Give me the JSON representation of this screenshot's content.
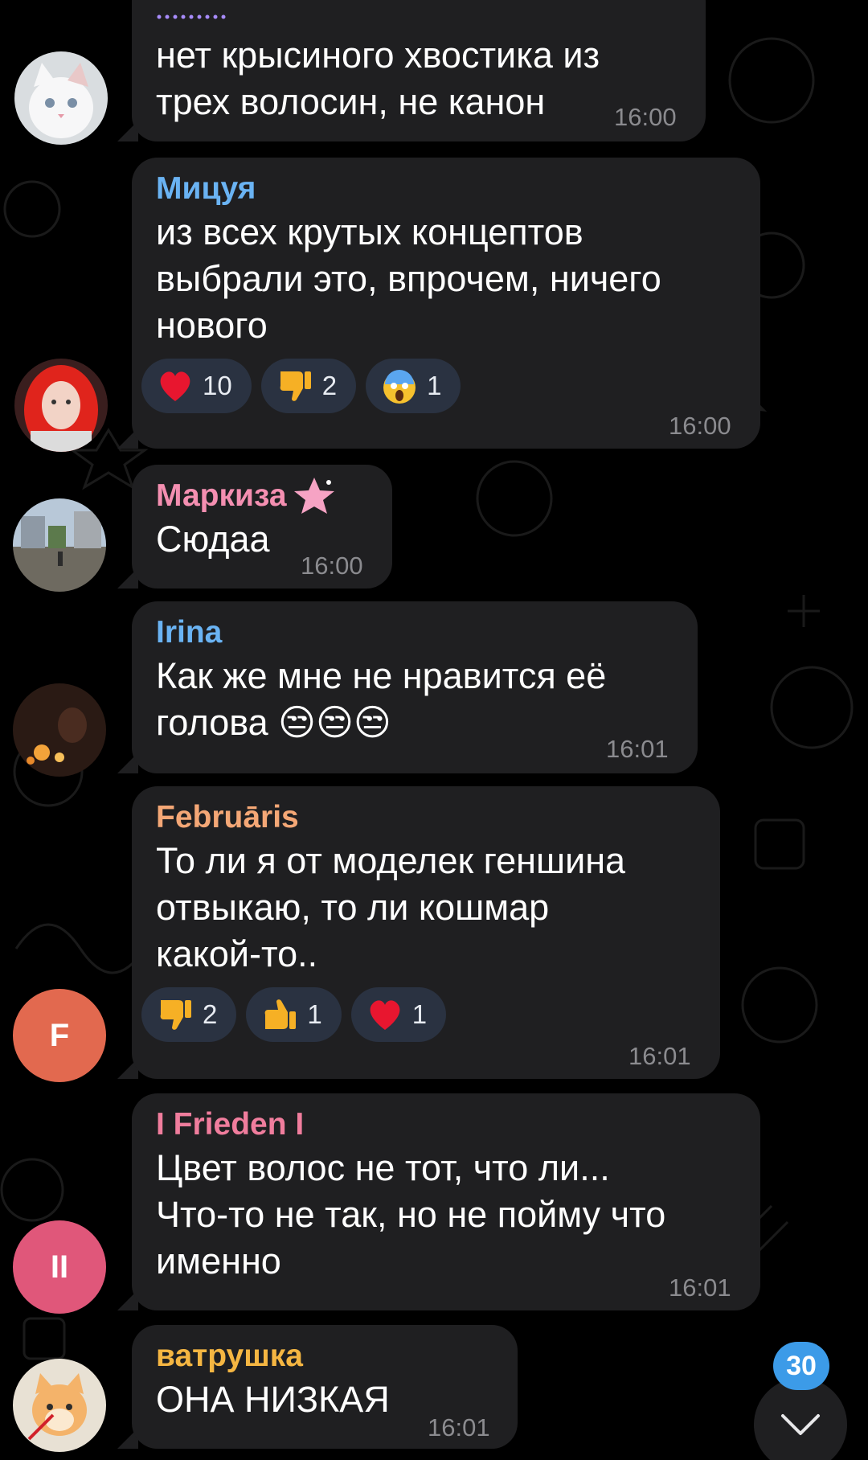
{
  "colors": {
    "background": "#000000",
    "bubble": "#1f1f21",
    "reaction_pill": "#2a3241",
    "time": "#8b8b8f",
    "accent": "#3c9be8"
  },
  "messages": [
    {
      "sender": "",
      "sender_color": "#a78bfa",
      "text": "нет крысиного хвостика из\nтрех волосин, не канон",
      "time": "16:00",
      "avatar": "white-kitten-avatar"
    },
    {
      "sender": "Мицуя",
      "sender_color": "#6ab3f3",
      "text": "из всех крутых концептов\nвыбрали это, впрочем, ничего\nнового",
      "time": "16:00",
      "avatar": "red-hair-girl-avatar",
      "reactions": [
        {
          "emoji": "heart",
          "count": "10"
        },
        {
          "emoji": "thumbs-down",
          "count": "2"
        },
        {
          "emoji": "scream",
          "count": "1"
        }
      ]
    },
    {
      "sender": "Маркиза",
      "sender_color": "#f48fb1",
      "badge": "pink-star-icon",
      "text": "Сюдаа",
      "time": "16:00",
      "avatar": "street-photo-avatar"
    },
    {
      "sender": "Irina",
      "sender_color": "#6ab3f3",
      "text": "Как же мне не нравится её\nголова 😒😒😒",
      "time": "16:01",
      "avatar": "candle-photo-avatar"
    },
    {
      "sender": "Februāris",
      "sender_color": "#f4a776",
      "text": "То ли я от моделек геншина\nотвыкаю, то ли кошмар\nкакой-то..",
      "time": "16:01",
      "avatar_letter": "F",
      "avatar_color": "#e2694f",
      "reactions": [
        {
          "emoji": "thumbs-down",
          "count": "2"
        },
        {
          "emoji": "thumbs-up",
          "count": "1"
        },
        {
          "emoji": "heart",
          "count": "1"
        }
      ]
    },
    {
      "sender": "I Frieden I",
      "sender_color": "#f07d9d",
      "text": "Цвет волос не тот, что ли...\nЧто-то не так, но не пойму что\nименно",
      "time": "16:01",
      "avatar_letter": "II",
      "avatar_color": "#e0577a"
    },
    {
      "sender": "ватрушка",
      "sender_color": "#f5b642",
      "text": "ОНА НИЗКАЯ",
      "time": "16:01",
      "avatar": "cat-photo-avatar"
    }
  ],
  "scroll_down": {
    "unread_count": "30",
    "icon": "chevron-down-icon"
  }
}
